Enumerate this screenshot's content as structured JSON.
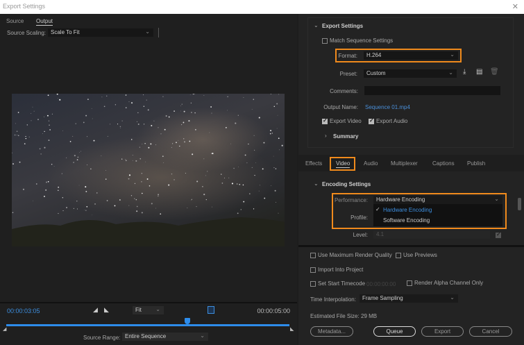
{
  "window": {
    "title": "Export Settings",
    "close_icon": "close-icon"
  },
  "left": {
    "tabs": [
      {
        "label": "Source"
      },
      {
        "label": "Output",
        "active": true
      }
    ],
    "source_scaling_label": "Source Scaling:",
    "source_scaling_value": "Scale To Fit",
    "current_time": "00:00:03:05",
    "end_time": "00:00:05:00",
    "zoom_value": "Fit",
    "playhead_position_fraction": 0.64,
    "source_range_label": "Source Range:",
    "source_range_value": "Entire Sequence"
  },
  "export_settings": {
    "section_title": "Export Settings",
    "match_sequence_label": "Match Sequence Settings",
    "match_sequence_checked": false,
    "format_label": "Format:",
    "format_value": "H.264",
    "preset_label": "Preset:",
    "preset_value": "Custom",
    "comments_label": "Comments:",
    "comments_value": "",
    "output_name_label": "Output Name:",
    "output_name_value": "Sequence 01.mp4",
    "export_video_label": "Export Video",
    "export_video_checked": true,
    "export_audio_label": "Export Audio",
    "export_audio_checked": true,
    "summary_label": "Summary"
  },
  "settings_tabs": [
    {
      "label": "Effects"
    },
    {
      "label": "Video",
      "active": true
    },
    {
      "label": "Audio"
    },
    {
      "label": "Multiplexer"
    },
    {
      "label": "Captions"
    },
    {
      "label": "Publish"
    }
  ],
  "encoding": {
    "section_title": "Encoding Settings",
    "performance_label": "Performance:",
    "performance_value": "Hardware Encoding",
    "options": [
      {
        "label": "Hardware Encoding",
        "selected": true
      },
      {
        "label": "Software Encoding"
      }
    ],
    "profile_label": "Profile:",
    "level_label": "Level:",
    "level_value": "4.1"
  },
  "bottom": {
    "max_render_quality_label": "Use Maximum Render Quality",
    "use_previews_label": "Use Previews",
    "import_into_project_label": "Import Into Project",
    "set_start_timecode_label": "Set Start Timecode",
    "start_timecode_value": "00:00:00:00",
    "render_alpha_label": "Render Alpha Channel Only",
    "time_interpolation_label": "Time Interpolation:",
    "time_interpolation_value": "Frame Sampling",
    "estimated_size_label": "Estimated File Size:",
    "estimated_size_value": "29 MB",
    "metadata_label": "Metadata...",
    "queue_label": "Queue",
    "export_label": "Export",
    "cancel_label": "Cancel"
  },
  "colors": {
    "highlight": "#f08a1c",
    "accent": "#2d8ceb",
    "link": "#4a8fd9"
  }
}
